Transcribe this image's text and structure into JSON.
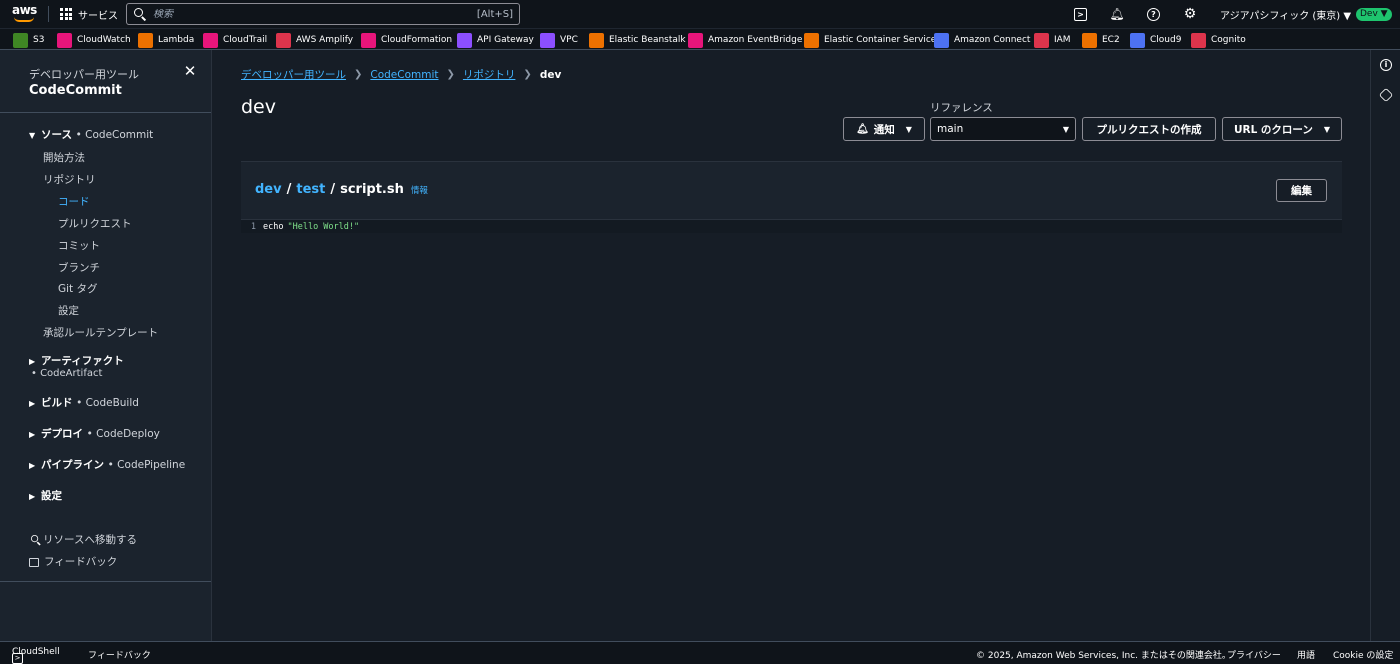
{
  "topbar": {
    "logo": "aws",
    "services_label": "サービス",
    "search_placeholder": "検索",
    "search_shortcut": "[Alt+S]",
    "region": "アジアパシフィック (東京) ▼",
    "account_badge": "Dev ▼"
  },
  "favorites": [
    {
      "label": "S3",
      "color": "#3f8624"
    },
    {
      "label": "CloudWatch",
      "color": "#e7157b"
    },
    {
      "label": "Lambda",
      "color": "#ed7100"
    },
    {
      "label": "CloudTrail",
      "color": "#e7157b"
    },
    {
      "label": "AWS Amplify",
      "color": "#dd344c"
    },
    {
      "label": "CloudFormation",
      "color": "#e7157b"
    },
    {
      "label": "API Gateway",
      "color": "#8c4fff"
    },
    {
      "label": "VPC",
      "color": "#8c4fff"
    },
    {
      "label": "Elastic Beanstalk",
      "color": "#ed7100"
    },
    {
      "label": "Amazon EventBridge",
      "color": "#e7157b"
    },
    {
      "label": "Elastic Container Service",
      "color": "#ed7100"
    },
    {
      "label": "Amazon Connect",
      "color": "#4d72f3"
    },
    {
      "label": "IAM",
      "color": "#dd344c"
    },
    {
      "label": "EC2",
      "color": "#ed7100"
    },
    {
      "label": "Cloud9",
      "color": "#4d72f3"
    },
    {
      "label": "Cognito",
      "color": "#dd344c"
    }
  ],
  "sidebar": {
    "subtitle": "デベロッパー用ツール",
    "title": "CodeCommit",
    "source_section": "ソース",
    "source_sub": "• CodeCommit",
    "items": {
      "getting_started": "開始方法",
      "repositories": "リポジトリ",
      "code": "コード",
      "pull_requests": "プルリクエスト",
      "commits": "コミット",
      "branches": "ブランチ",
      "git_tags": "Git タグ",
      "settings": "設定",
      "approval_templates": "承認ルールテンプレート"
    },
    "artifacts": "アーティファクト",
    "artifacts_sub": "• CodeArtifact",
    "build": "ビルド",
    "build_sub": "• CodeBuild",
    "deploy": "デプロイ",
    "deploy_sub": "• CodeDeploy",
    "pipeline": "パイプライン",
    "pipeline_sub": "• CodePipeline",
    "settings": "設定",
    "go_to_resource": "リソースへ移動する",
    "feedback": "フィードバック"
  },
  "breadcrumb": {
    "dev_tools": "デベロッパー用ツール",
    "codecommit": "CodeCommit",
    "repositories": "リポジトリ",
    "current": "dev"
  },
  "page": {
    "title": "dev",
    "reference_label": "リファレンス",
    "notify_button": "通知",
    "branch_value": "main",
    "create_pr_button": "プルリクエストの作成",
    "clone_url_button": "URL のクローン"
  },
  "file": {
    "repo": "dev",
    "folder": "test",
    "filename": "script.sh",
    "info_link": "情報",
    "edit_button": "編集",
    "lines": [
      {
        "number": "1",
        "keyword": "echo",
        "string": "\"Hello World!\""
      }
    ]
  },
  "footer": {
    "cloudshell": "CloudShell",
    "feedback": "フィードバック",
    "copyright": "© 2025, Amazon Web Services, Inc. またはその関連会社。",
    "privacy": "プライバシー",
    "terms": "用語",
    "cookie": "Cookie の設定"
  }
}
